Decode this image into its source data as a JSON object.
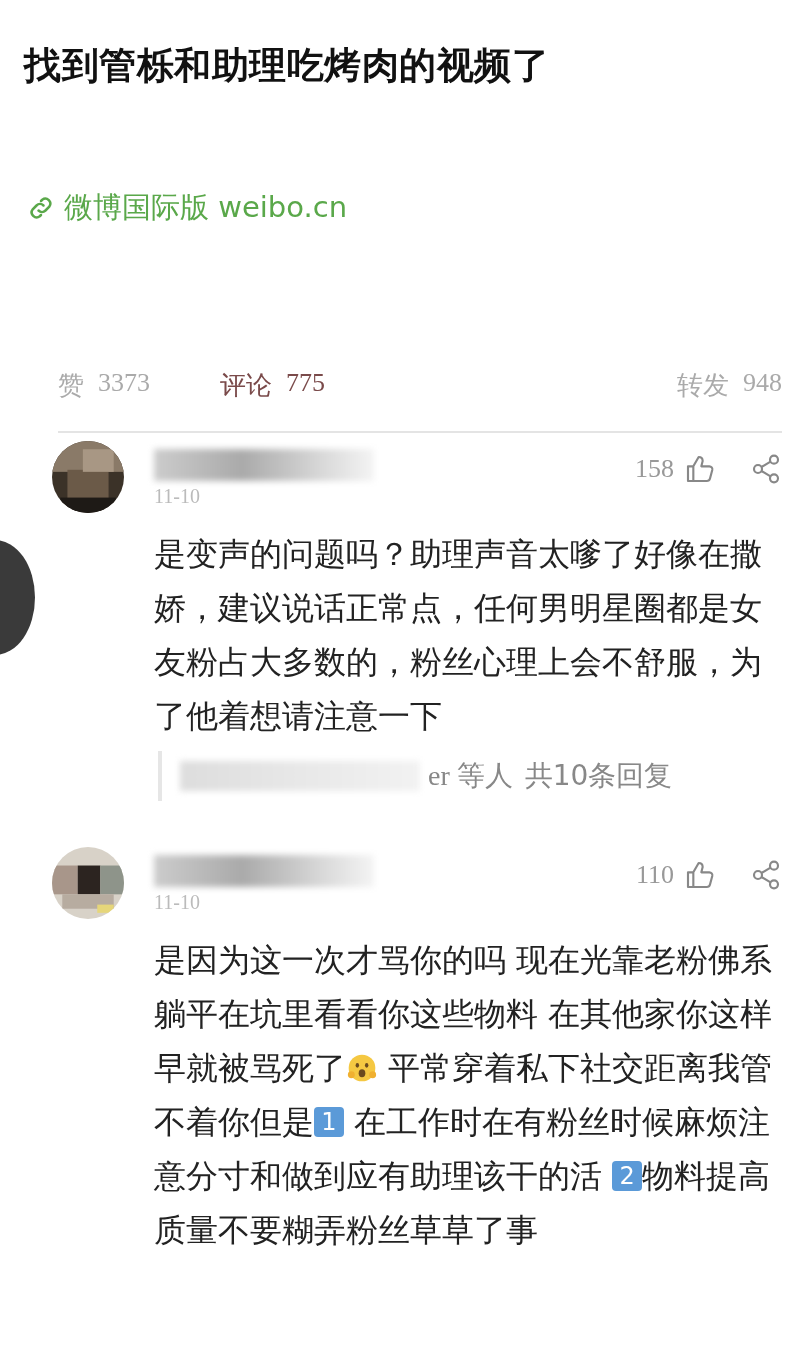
{
  "post": {
    "title": "找到管栎和助理吃烤肉的视频了",
    "link": {
      "text": "微博国际版 weibo.cn"
    }
  },
  "stats": [
    {
      "label": "赞",
      "count": "3373",
      "selected": false
    },
    {
      "label": "评论",
      "count": "775",
      "selected": true
    },
    {
      "label": "转发",
      "count": "948",
      "selected": false
    }
  ],
  "comments": [
    {
      "date": "11-10",
      "likes": "158",
      "segments": [
        {
          "kind": "text",
          "text": "是变声的问题吗？助理声音太嗲了好像在撒娇，建议说话正常点，任何男明星圈都是女友粉占大多数的，粉丝心理上会不舒服，为了他着想请注意一下"
        }
      ],
      "replies": {
        "names": "er 等人",
        "total": "共10条回复"
      }
    },
    {
      "date": "11-10",
      "likes": "110",
      "segments": [
        {
          "kind": "text",
          "text": "是因为这一次才骂你的吗 现在光靠老粉佛系躺平在坑里看看你这些物料 在其他家你这样早就被骂死了"
        },
        {
          "kind": "emoji"
        },
        {
          "kind": "text",
          "text": " 平常穿着私下社交距离我管不着你但是"
        },
        {
          "kind": "keycap",
          "text": "1"
        },
        {
          "kind": "text",
          "text": " 在工作时在有粉丝时候麻烦注意分寸和做到应有助理该干的活 "
        },
        {
          "kind": "keycap",
          "text": "2"
        },
        {
          "kind": "text",
          "text": "物料提高质量不要糊弄粉丝草草了事"
        }
      ]
    }
  ]
}
